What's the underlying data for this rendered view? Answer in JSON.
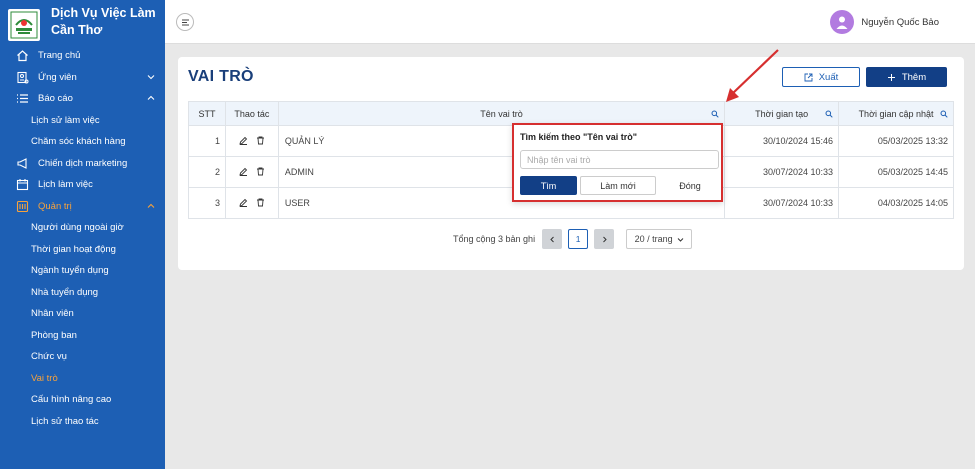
{
  "brand": {
    "title": "Dịch Vụ Việc Làm Cần Thơ"
  },
  "sidebar": {
    "items": [
      {
        "label": "Trang chủ",
        "icon": "home-icon"
      },
      {
        "label": "Ứng viên",
        "icon": "document-person-icon",
        "expandable": true
      },
      {
        "label": "Báo cáo",
        "icon": "list-icon",
        "expandable": true,
        "expanded": true
      },
      {
        "label": "Lịch sử làm việc",
        "sub": true
      },
      {
        "label": "Chăm sóc khách hàng",
        "sub": true
      },
      {
        "label": "Chiến dịch marketing",
        "icon": "megaphone-icon"
      },
      {
        "label": "Lịch làm việc",
        "icon": "calendar-icon"
      },
      {
        "label": "Quản trị",
        "icon": "admin-icon",
        "expandable": true,
        "expanded": true,
        "active": true
      },
      {
        "label": "Người dùng ngoài giờ",
        "sub": true
      },
      {
        "label": "Thời gian hoạt động",
        "sub": true
      },
      {
        "label": "Ngành tuyển dụng",
        "sub": true
      },
      {
        "label": "Nhà tuyển dụng",
        "sub": true
      },
      {
        "label": "Nhân viên",
        "sub": true
      },
      {
        "label": "Phòng ban",
        "sub": true
      },
      {
        "label": "Chức vụ",
        "sub": true
      },
      {
        "label": "Vai trò",
        "sub": true,
        "active": true
      },
      {
        "label": "Cấu hình nâng cao",
        "sub": true
      },
      {
        "label": "Lịch sử thao tác",
        "sub": true
      }
    ]
  },
  "topbar": {
    "username": "Nguyễn Quốc Bảo"
  },
  "page": {
    "title": "VAI TRÒ",
    "export_label": "Xuất",
    "add_label": "Thêm"
  },
  "table": {
    "headers": {
      "stt": "STT",
      "actions": "Thao tác",
      "name": "Tên vai trò",
      "created": "Thời gian tạo",
      "updated": "Thời gian cập nhật"
    },
    "rows": [
      {
        "stt": "1",
        "name": "QUẢN LÝ",
        "created": "30/10/2024 15:46",
        "updated": "05/03/2025 13:32"
      },
      {
        "stt": "2",
        "name": "ADMIN",
        "created": "30/07/2024 10:33",
        "updated": "05/03/2025 14:45"
      },
      {
        "stt": "3",
        "name": "USER",
        "created": "30/07/2024 10:33",
        "updated": "04/03/2025 14:05"
      }
    ]
  },
  "pagination": {
    "total": "Tổng cộng 3 bản ghi",
    "current": "1",
    "page_size": "20 / trang"
  },
  "filter_popup": {
    "title": "Tìm kiếm theo \"Tên vai trò\"",
    "placeholder": "Nhập tên vai trò",
    "find_label": "Tìm",
    "reset_label": "Làm mới",
    "close_label": "Đóng"
  },
  "colors": {
    "sidebar": "#1d5fb4",
    "active": "#f7a23b",
    "primary": "#123f86",
    "highlight": "#d62f2f"
  }
}
